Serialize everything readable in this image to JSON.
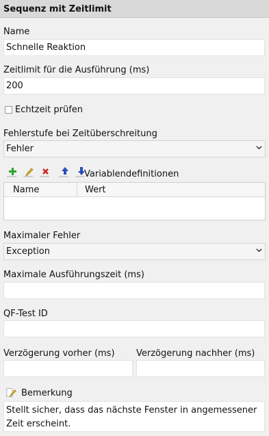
{
  "header": {
    "title": "Sequenz mit Zeitlimit"
  },
  "name": {
    "label": "Name",
    "value": "Schnelle Reaktion"
  },
  "timeout": {
    "label": "Zeitlimit für die Ausführung (ms)",
    "value": "200"
  },
  "realtime": {
    "label": "Echtzeit prüfen",
    "checked": false
  },
  "error_level": {
    "label": "Fehlerstufe bei Zeitüberschreitung",
    "value": "Fehler"
  },
  "variables": {
    "label": "Variablendefinitionen",
    "toolbar": [
      "add-icon",
      "edit-icon",
      "delete-icon",
      "move-up-icon",
      "move-down-icon"
    ],
    "columns": [
      "Name",
      "Wert"
    ],
    "rows": []
  },
  "max_error": {
    "label": "Maximaler Fehler",
    "value": "Exception"
  },
  "max_exec_time": {
    "label": "Maximale Ausführungszeit (ms)",
    "value": ""
  },
  "qftest_id": {
    "label": "QF-Test ID",
    "value": ""
  },
  "delay_before": {
    "label": "Verzögerung vorher (ms)",
    "value": ""
  },
  "delay_after": {
    "label": "Verzögerung nachher (ms)",
    "value": ""
  },
  "comment": {
    "label": "Bemerkung",
    "value": "Stellt sicher, dass das nächste Fenster in angemessener Zeit erscheint."
  },
  "colors": {
    "header_bg": "#d9d9d9",
    "panel_bg": "#f0f0f0",
    "add": "#2aa52a",
    "delete": "#d02020",
    "arrow": "#2a4fb8",
    "pencil": "#e0b020"
  }
}
